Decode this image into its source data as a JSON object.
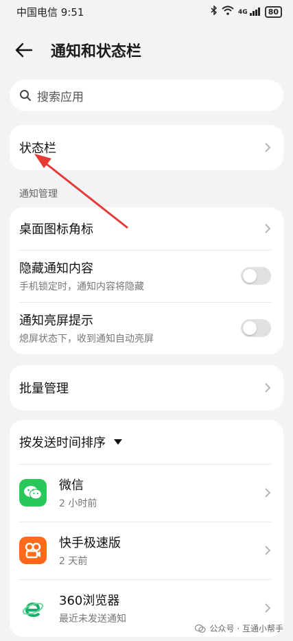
{
  "status_bar": {
    "carrier_time": "中国电信 9:51",
    "network": "4G",
    "battery": "80"
  },
  "header": {
    "title": "通知和状态栏"
  },
  "search": {
    "placeholder": "搜索应用"
  },
  "status_bar_item": {
    "label": "状态栏"
  },
  "notification_section": {
    "label": "通知管理"
  },
  "settings": [
    {
      "title": "桌面图标角标"
    },
    {
      "title": "隐藏通知内容",
      "subtitle": "手机锁定时，通知内容将隐藏"
    },
    {
      "title": "通知亮屏提示",
      "subtitle": "熄屏状态下，收到通知自动亮屏"
    }
  ],
  "batch": {
    "label": "批量管理"
  },
  "apps_card": {
    "sort_label": "按发送时间排序",
    "apps": [
      {
        "name": "微信",
        "time": "2 小时前"
      },
      {
        "name": "快手极速版",
        "time": "2 天前"
      },
      {
        "name": "360浏览器",
        "time": "最近未发送通知"
      }
    ]
  },
  "watermark": {
    "text": "公众号 · 互通小帮手"
  },
  "colors": {
    "accent_arrow": "#e53935",
    "wechat": "#2ac75a",
    "kuaishou": "#ff6a1a",
    "browser360": "#17b26a"
  }
}
